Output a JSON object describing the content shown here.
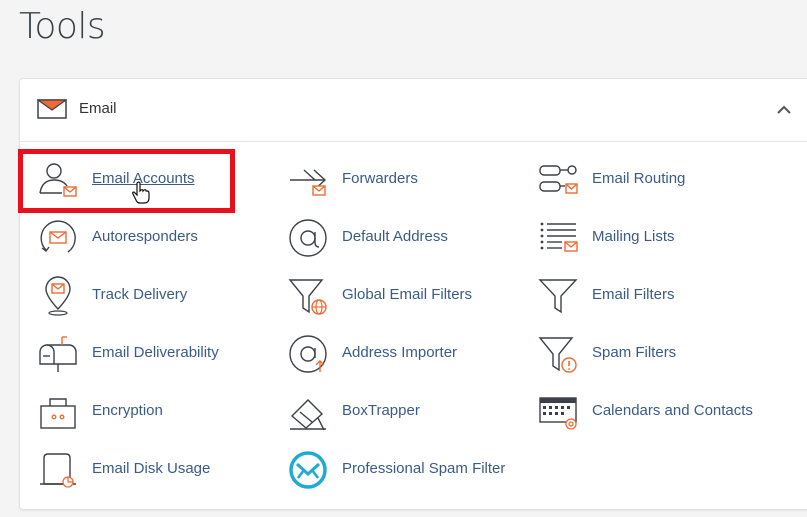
{
  "page": {
    "title": "Tools"
  },
  "panel": {
    "title": "Email",
    "icon": "envelope-icon",
    "collapse_icon": "chevron-up-icon"
  },
  "tools": [
    {
      "label": "Email Accounts",
      "icon": "user-mail-icon"
    },
    {
      "label": "Forwarders",
      "icon": "forward-arrow-icon"
    },
    {
      "label": "Email Routing",
      "icon": "routing-icon"
    },
    {
      "label": "Autoresponders",
      "icon": "autoresponder-icon"
    },
    {
      "label": "Default Address",
      "icon": "at-sign-icon"
    },
    {
      "label": "Mailing Lists",
      "icon": "mailing-list-icon"
    },
    {
      "label": "Track Delivery",
      "icon": "location-pin-icon"
    },
    {
      "label": "Global Email Filters",
      "icon": "global-filter-icon"
    },
    {
      "label": "Email Filters",
      "icon": "filter-funnel-icon"
    },
    {
      "label": "Email Deliverability",
      "icon": "mailbox-icon"
    },
    {
      "label": "Address Importer",
      "icon": "at-import-icon"
    },
    {
      "label": "Spam Filters",
      "icon": "spam-filter-icon"
    },
    {
      "label": "Encryption",
      "icon": "encryption-icon"
    },
    {
      "label": "BoxTrapper",
      "icon": "boxtrapper-icon"
    },
    {
      "label": "Calendars and Contacts",
      "icon": "calendar-icon"
    },
    {
      "label": "Email Disk Usage",
      "icon": "disk-usage-icon"
    },
    {
      "label": "Professional Spam Filter",
      "icon": "spam-shield-icon"
    }
  ],
  "colors": {
    "accent_orange": "#f26a32",
    "link_blue": "#3b5b87",
    "icon_stroke": "#3c4148",
    "highlight_red": "#e8101c",
    "spam_filter_blue": "#1eaad5"
  }
}
